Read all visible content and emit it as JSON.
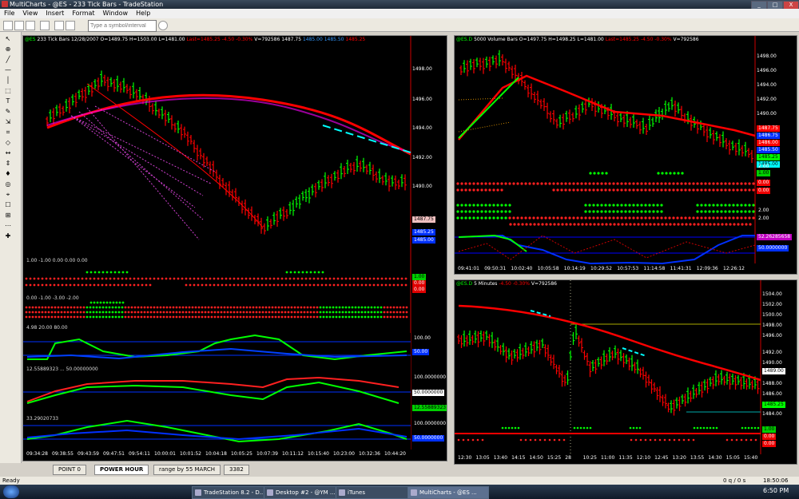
{
  "window": {
    "title": "MultiCharts - @ES - 233 Tick Bars - TradeStation",
    "buttons": {
      "min": "_",
      "max": "□",
      "close": "X"
    }
  },
  "menu": [
    "File",
    "View",
    "Insert",
    "Format",
    "Window",
    "Help"
  ],
  "toolbar": {
    "symbol_placeholder": "Type a symbol/interval"
  },
  "left_tools": [
    "↖",
    "⊕",
    "╱",
    "—",
    "│",
    "⬚",
    "T",
    "✎",
    "⇲",
    "⌗",
    "◇",
    "↔",
    "⇕",
    "♦",
    "◎",
    "⌖",
    "☐",
    "⊞",
    "⋯",
    "✚"
  ],
  "chart1": {
    "header": {
      "symbol": "@ES",
      "interval": "233 Tick Bars",
      "date": "12/28/2007",
      "open": "O=1489.75",
      "high": "H=1503.00",
      "low": "L=1481.00",
      "last": "Last=1485.25 -4.50 -0.30%",
      "vol": "V=792586",
      "price": "1487.75",
      "bid": "1485.00",
      "ask": "1485.50",
      "ext": "1485.25"
    },
    "price_labels": [
      "1498.00",
      "1496.00",
      "1494.00",
      "1492.00",
      "1490.00"
    ],
    "tags": {
      "pink": "1487.75",
      "blue1": "1485.25",
      "blue2": "1485.00"
    },
    "ind1_label": "1.00  -1.00  0.00  0.00  0.00",
    "ind2_label": "0.00  -1.00  -3.00  -2.00",
    "ind3_label": "4.98  20.00  80.00",
    "ind3_levels": [
      "100.00",
      "50.00"
    ],
    "ind4_label": "12.55889323  ...  50.00000000",
    "ind4_levels": [
      "100.0000000",
      "50.0000000",
      "12.55889323"
    ],
    "ind5_label": "33.29020733",
    "ind5_levels": [
      "100.0000000",
      "50.0000000"
    ],
    "time_labels": [
      "09:34:28",
      "09:38:55",
      "09:43:59",
      "09:47:51",
      "09:54:11",
      "10:00:01",
      "10:01:52",
      "10:04:18",
      "10:05:25",
      "10:07:39",
      "10:11:12",
      "10:15:40",
      "10:23:00",
      "10:32:36",
      "10:44:20"
    ],
    "ind_tags": {
      "a": "1.00",
      "b": "0.00",
      "c": "0.00"
    }
  },
  "chart2": {
    "header": {
      "symbol": "@ES.D",
      "interval": "5000 Volume Bars",
      "open": "O=1497.75",
      "high": "H=1498.25",
      "low": "L=1481.00",
      "last": "Last=1485.25 -4.50 -0.30%",
      "vol": "V=792586"
    },
    "price_labels": [
      "1498.00",
      "1496.00",
      "1494.00",
      "1492.00",
      "1490.00"
    ],
    "tags": [
      "1487.75",
      "1486.75",
      "1486.00",
      "1485.50",
      "1485.25",
      "1485.00"
    ],
    "ind_levels": [
      "2.00",
      "1.00",
      "0.00",
      "0.00",
      "2.00",
      "2.00",
      "52.26285658",
      "50.0000000"
    ],
    "time_labels": [
      "09:41:01",
      "09:50:31",
      "10:02:40",
      "10:05:58",
      "10:14:19",
      "10:29:52",
      "10:57:53",
      "11:14:58",
      "11:41:31",
      "12:09:36",
      "12:26:12"
    ]
  },
  "chart3": {
    "header": {
      "symbol": "@ES.D",
      "interval": "5 Minutes",
      "last": "-4.50 -0.30%",
      "vol": "V=792586"
    },
    "price_labels": [
      "1504.00",
      "1502.00",
      "1500.00",
      "1498.00",
      "1496.00",
      "1492.00",
      "1490.00",
      "1488.00",
      "1486.00",
      "1484.00"
    ],
    "tags": [
      "1489.00",
      "1485.25"
    ],
    "ind_tags": [
      "1.00",
      "0.00",
      "0.00"
    ],
    "time_labels": [
      "12:30",
      "13:05",
      "13:40",
      "14:15",
      "14:50",
      "15:25",
      "28",
      "10:25",
      "11:00",
      "11:35",
      "12:10",
      "12:45",
      "13:20",
      "13:55",
      "14:30",
      "15:05",
      "15:40"
    ]
  },
  "tabs": [
    "POINT 0",
    "POWER HOUR",
    "range by 55 MARCH",
    "3382"
  ],
  "status": {
    "left": "Ready",
    "mid": "0 q / 0 s",
    "time": "18:50:06"
  },
  "taskbar": {
    "items": [
      "TradeStation 8.2 - D...",
      "Desktop #2 - @YM ...",
      "iTunes",
      "MultiCharts - @ES ..."
    ],
    "clock": "6:50 PM"
  },
  "colors": {
    "bull": "#00ff00",
    "bear": "#ff0000",
    "ma": "#ff0000",
    "magenta": "#ff00ff",
    "cyan": "#00ffff",
    "blue": "#0000ff"
  }
}
